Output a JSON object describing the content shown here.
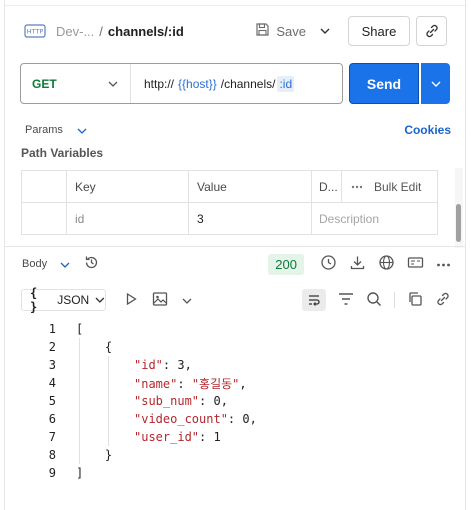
{
  "header": {
    "method_icon": "http-icon",
    "crumb_parent": "Dev-...",
    "crumb_sep": "/",
    "crumb_current": "channels/:id",
    "save_label": "Save",
    "share_label": "Share"
  },
  "request": {
    "method": "GET",
    "url_prefix": "http://",
    "url_host_var": "{{host}}",
    "url_path": "/channels/",
    "url_param": ":id",
    "send_label": "Send"
  },
  "params": {
    "tab_label": "Params",
    "cookies_label": "Cookies",
    "section_title": "Path Variables",
    "columns": {
      "key": "Key",
      "value": "Value",
      "description": "D...",
      "bulk_edit": "Bulk Edit"
    },
    "rows": [
      {
        "key": "id",
        "value": "3",
        "description_placeholder": "Description"
      }
    ]
  },
  "response": {
    "body_label": "Body",
    "status_code": "200",
    "format_label": "JSON",
    "format_braces": "{ }",
    "code_lines": [
      {
        "n": "1",
        "text": "["
      },
      {
        "n": "2",
        "text": "    {"
      },
      {
        "n": "3",
        "key": "\"id\"",
        "val": " 3,"
      },
      {
        "n": "4",
        "key": "\"name\"",
        "val_str": "\"홍길동\"",
        "tail": ","
      },
      {
        "n": "5",
        "key": "\"sub_num\"",
        "val": " 0,"
      },
      {
        "n": "6",
        "key": "\"video_count\"",
        "val": " 0,"
      },
      {
        "n": "7",
        "key": "\"user_id\"",
        "val": " 1"
      },
      {
        "n": "8",
        "text": "    }"
      },
      {
        "n": "9",
        "text": "]"
      }
    ]
  },
  "colors": {
    "accent": "#1a73e8",
    "method_get": "#0c7a3a",
    "json_key": "#b3282d",
    "status_ok_bg": "#e5f4e8"
  }
}
